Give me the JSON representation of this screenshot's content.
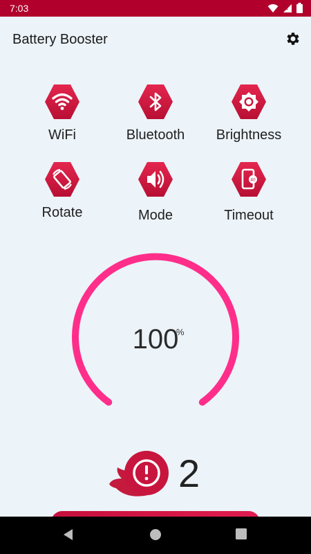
{
  "status_bar": {
    "time": "7:03",
    "icons": [
      "wifi-icon",
      "signal-icon",
      "battery-icon"
    ],
    "color": "#b1002c"
  },
  "app_bar": {
    "title": "Battery Booster",
    "settings_icon": "gear-icon"
  },
  "toggles": [
    {
      "label": "WiFi",
      "icon": "wifi-icon"
    },
    {
      "label": "Bluetooth",
      "icon": "bluetooth-icon"
    },
    {
      "label": "Brightness",
      "icon": "brightness-icon"
    },
    {
      "label": "Rotate",
      "icon": "rotate-icon"
    },
    {
      "label": "Mode",
      "icon": "volume-icon"
    },
    {
      "label": "Timeout",
      "icon": "phone-timer-icon"
    }
  ],
  "battery": {
    "value": "100",
    "unit": "%",
    "level_fraction": 1.0,
    "ring_color": "#ff2e8a"
  },
  "alerts": {
    "count": "2",
    "icon": "exclamation-icon"
  },
  "colors": {
    "accent": "#c8153d",
    "background": "#ecf3f9"
  },
  "nav": {
    "icons": [
      "back-icon",
      "home-icon",
      "recents-icon"
    ]
  }
}
